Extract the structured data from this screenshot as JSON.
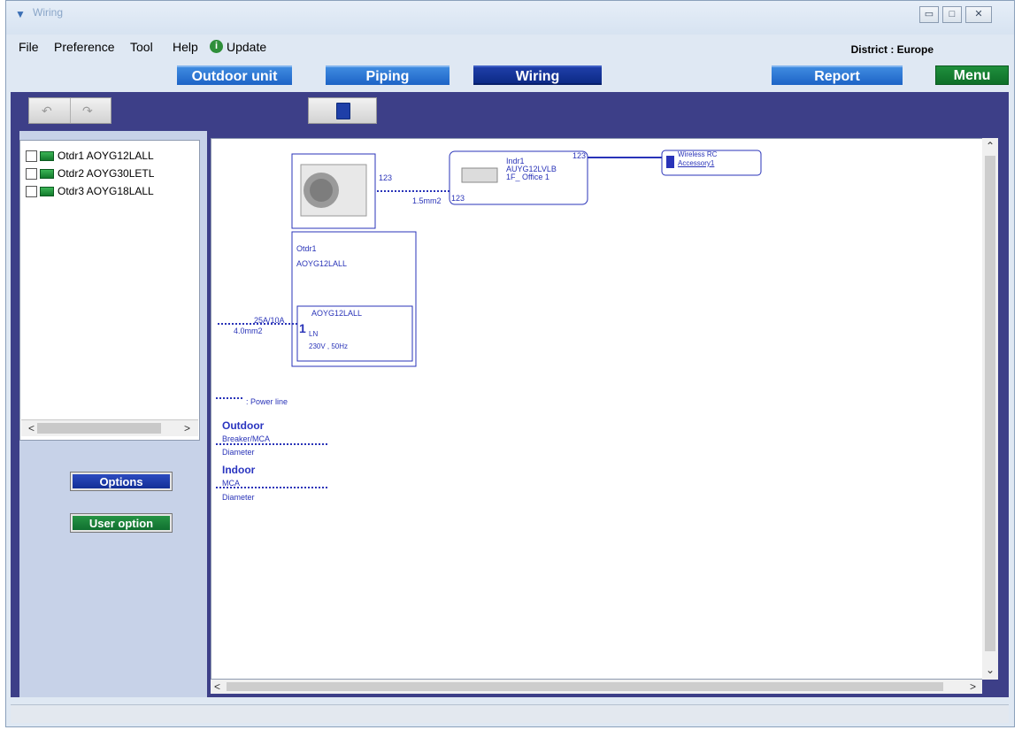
{
  "window": {
    "title": "Wiring"
  },
  "menu": {
    "items": [
      "File",
      "Preference",
      "Tool",
      "Help"
    ],
    "update": "Update",
    "district": "District : Europe"
  },
  "tabs": {
    "outdoor": "Outdoor unit",
    "piping": "Piping",
    "wiring": "Wiring",
    "report": "Report",
    "menu": "Menu"
  },
  "units": [
    {
      "label": "Otdr1 AOYG12LALL"
    },
    {
      "label": "Otdr2 AOYG30LETL"
    },
    {
      "label": "Otdr3 AOYG18LALL"
    }
  ],
  "panel": {
    "options": "Options",
    "user_option": "User option"
  },
  "diagram": {
    "outdoor_port": "123",
    "cable_1": "1.5mm2",
    "indoor_port_right": "123",
    "indoor_port_left": "123",
    "indoor_name": "Indr1",
    "indoor_model": "AUYG12LVLB",
    "indoor_location": "1F_ Office 1",
    "rc_name": "Wireless RC",
    "rc_accessory": "Accessory1",
    "otdr_name": "Otdr1",
    "otdr_model": "AOYG12LALL",
    "inner_model": "AOYG12LALL",
    "inner_ln": "LN",
    "inner_power": "230V , 50Hz",
    "inner_number": "1",
    "breaker": "25A/10A",
    "cable_2": "4.0mm2"
  },
  "legend": {
    "power_line": ": Power line",
    "outdoor": "Outdoor",
    "breaker_mca": "Breaker/MCA",
    "diameter_1": "Diameter",
    "indoor": "Indoor",
    "mca": "MCA",
    "diameter_2": "Diameter"
  }
}
